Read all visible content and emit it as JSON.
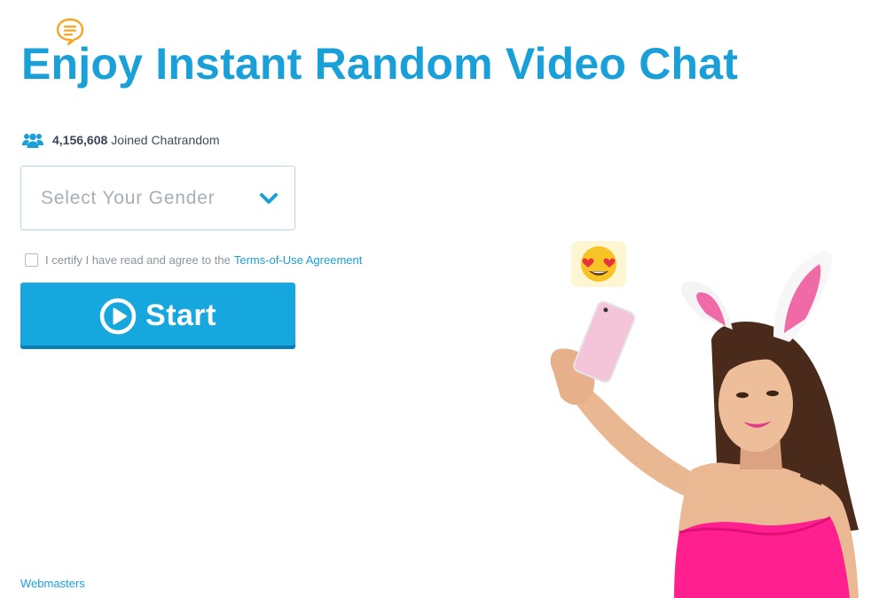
{
  "header": {
    "title": "Enjoy Instant Random Video Chat",
    "chat_icon": "speech-bubble-icon"
  },
  "stats": {
    "icon": "users-icon",
    "count": "4,156,608",
    "label": "Joined Chatrandom"
  },
  "gender_select": {
    "placeholder": "Select Your Gender",
    "icon": "chevron-down-icon"
  },
  "terms": {
    "checked": false,
    "text": "I certify I have read and agree to the",
    "link_label": "Terms-of-Use Agreement"
  },
  "start_button": {
    "label": "Start",
    "icon": "play-circle-icon"
  },
  "footer": {
    "webmasters_label": "Webmasters"
  },
  "hero": {
    "emoji": "heart-eyes-emoji-icon"
  },
  "colors": {
    "brand_blue": "#1aa0d8",
    "button_blue": "#16a7df",
    "icon_orange": "#f6a623"
  }
}
